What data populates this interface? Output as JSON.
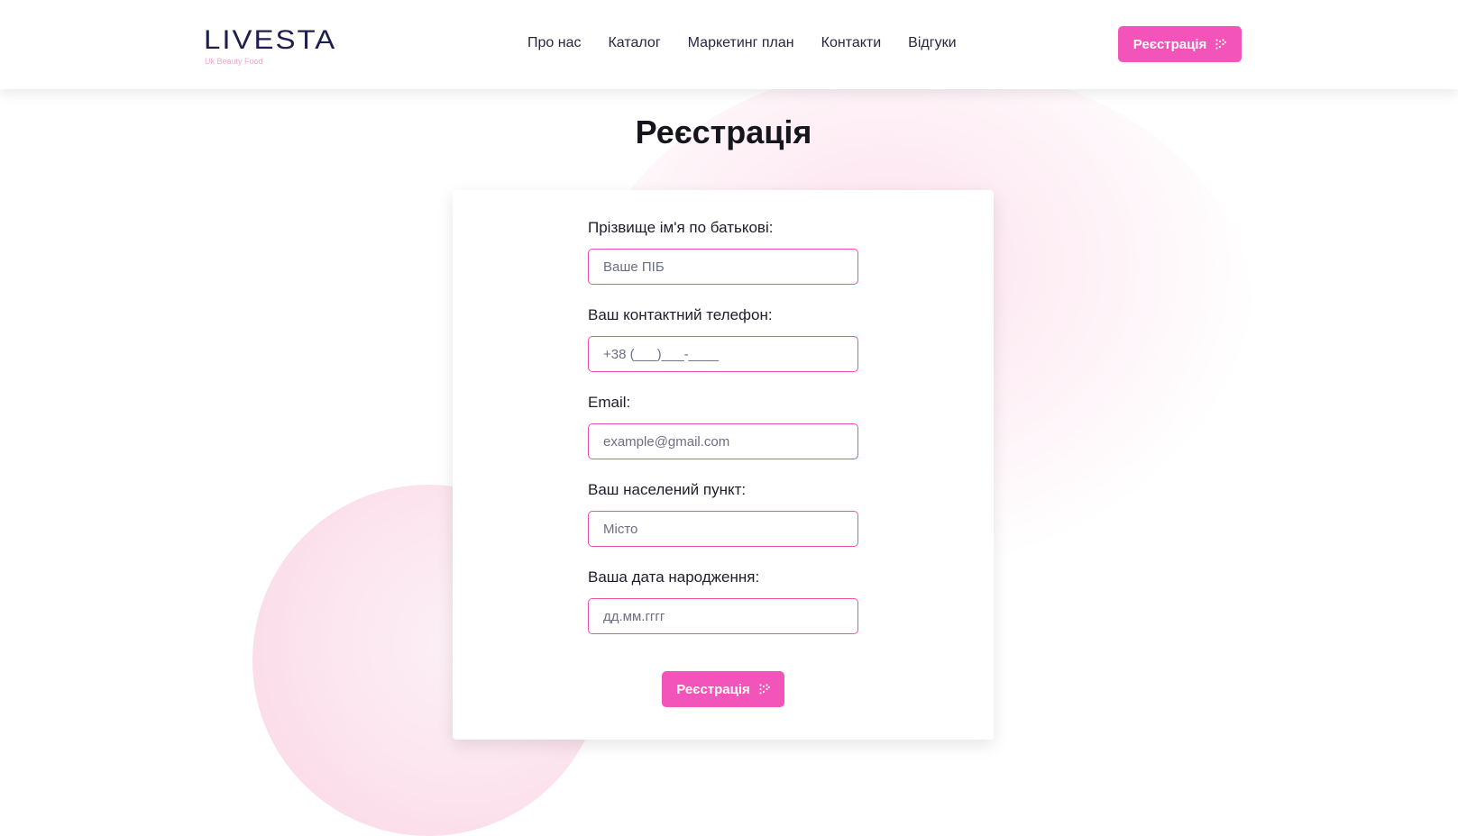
{
  "header": {
    "logo_text": "LIVESTA",
    "logo_tagline": "Uk Beauty Food",
    "nav": [
      {
        "label": "Про нас"
      },
      {
        "label": "Каталог"
      },
      {
        "label": "Маркетинг план"
      },
      {
        "label": "Контакти"
      },
      {
        "label": "Відгуки"
      }
    ],
    "register_label": "Реєстрація"
  },
  "page": {
    "title": "Реєстрація"
  },
  "form": {
    "fields": [
      {
        "label": "Прізвище ім'я по батькові:",
        "placeholder": "Ваше ПІБ",
        "value": ""
      },
      {
        "label": "Ваш контактний телефон:",
        "placeholder": "+38 (___)___-____",
        "value": ""
      },
      {
        "label": "Email:",
        "placeholder": "example@gmail.com",
        "value": ""
      },
      {
        "label": "Ваш населений пункт:",
        "placeholder": "Місто",
        "value": ""
      },
      {
        "label": "Ваша дата народження:",
        "placeholder": "дд.мм.гггг",
        "value": ""
      }
    ],
    "submit_label": "Реєстрація"
  },
  "colors": {
    "accent": "#f254b9",
    "input_border": "#ee4fae",
    "logo": "#1d1f4f",
    "background_blob": "#fce6ef"
  },
  "icons": {
    "register_button_icon": "dots-arrow-icon"
  }
}
